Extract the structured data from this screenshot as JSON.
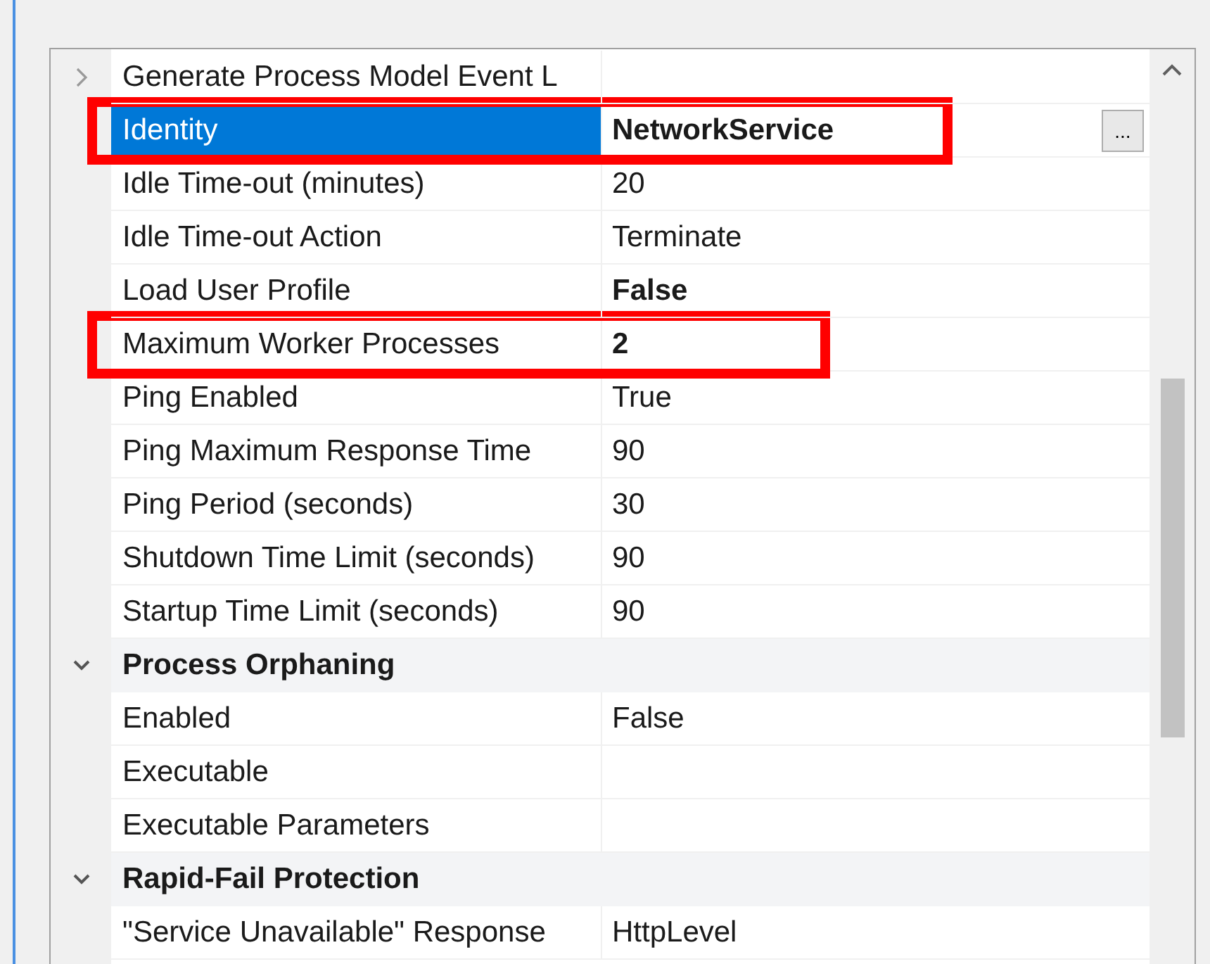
{
  "properties": [
    {
      "kind": "property",
      "name": "Generate Process Model Event L",
      "expanded": false,
      "selected": false,
      "highlighted": false
    },
    {
      "kind": "property",
      "name": "Identity",
      "value": "NetworkService",
      "selected": true,
      "modified": true,
      "highlighted": true,
      "button": "..."
    },
    {
      "kind": "property",
      "name": "Idle Time-out (minutes)",
      "value": "20",
      "selected": false,
      "modified": false,
      "highlighted": false
    },
    {
      "kind": "property",
      "name": "Idle Time-out Action",
      "value": "Terminate",
      "selected": false,
      "modified": false,
      "highlighted": false
    },
    {
      "kind": "property",
      "name": "Load User Profile",
      "value": "False",
      "selected": false,
      "modified": true,
      "highlighted": false
    },
    {
      "kind": "property",
      "name": "Maximum Worker Processes",
      "value": "2",
      "selected": false,
      "modified": true,
      "highlighted": true
    },
    {
      "kind": "property",
      "name": "Ping Enabled",
      "value": "True",
      "selected": false,
      "modified": false,
      "highlighted": false
    },
    {
      "kind": "property",
      "name": "Ping Maximum Response Time",
      "value": "90",
      "selected": false,
      "modified": false,
      "highlighted": false
    },
    {
      "kind": "property",
      "name": "Ping Period (seconds)",
      "value": "30",
      "selected": false,
      "modified": false,
      "highlighted": false
    },
    {
      "kind": "property",
      "name": "Shutdown Time Limit (seconds)",
      "value": "90",
      "selected": false,
      "modified": false,
      "highlighted": false
    },
    {
      "kind": "property",
      "name": "Startup Time Limit (seconds)",
      "value": "90",
      "selected": false,
      "modified": false,
      "highlighted": false
    },
    {
      "kind": "category",
      "name": "Process Orphaning",
      "expanded": true
    },
    {
      "kind": "property",
      "name": "Enabled",
      "value": "False",
      "selected": false,
      "modified": false,
      "highlighted": false
    },
    {
      "kind": "property",
      "name": "Executable",
      "selected": false,
      "highlighted": false
    },
    {
      "kind": "property",
      "name": "Executable Parameters",
      "selected": false,
      "highlighted": false
    },
    {
      "kind": "category",
      "name": "Rapid-Fail Protection",
      "expanded": true
    },
    {
      "kind": "property",
      "name": "\"Service Unavailable\" Response",
      "value": "HttpLevel",
      "selected": false,
      "modified": false,
      "highlighted": false
    }
  ]
}
